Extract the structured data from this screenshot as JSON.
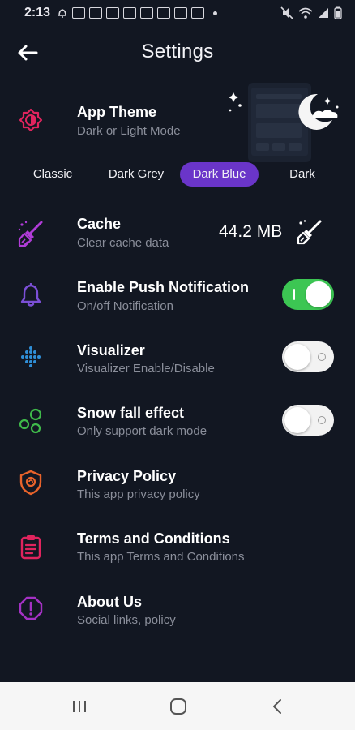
{
  "status_bar": {
    "time": "2:13",
    "notification_count": 8
  },
  "header": {
    "title": "Settings",
    "back_icon": "arrow-left-icon"
  },
  "theme": {
    "title": "App Theme",
    "subtitle": "Dark or Light Mode",
    "icon": "brightness-icon",
    "icon_color": "#e0245e",
    "options": [
      "Classic",
      "Dark Grey",
      "Dark Blue",
      "Dark"
    ],
    "selected": "Dark Blue",
    "selected_color": "#6a35c9"
  },
  "cache": {
    "title": "Cache",
    "subtitle": "Clear cache data",
    "size": "44.2 MB",
    "icon": "broom-icon",
    "icon_color": "#b03cd8"
  },
  "push_notification": {
    "title": "Enable Push Notification",
    "subtitle": "On/off Notification",
    "enabled": true,
    "icon": "bell-icon",
    "icon_color": "#7b4fd6"
  },
  "visualizer": {
    "title": "Visualizer",
    "subtitle": "Visualizer Enable/Disable",
    "enabled": false,
    "icon": "waveform-icon",
    "icon_color": "#2f8fd8"
  },
  "snow_fall": {
    "title": "Snow fall effect",
    "subtitle": "Only support dark mode",
    "enabled": false,
    "icon": "bubbles-icon",
    "icon_color": "#3fb94a"
  },
  "privacy_policy": {
    "title": "Privacy Policy",
    "subtitle": "This app privacy policy",
    "icon": "shield-icon",
    "icon_color": "#e8632b"
  },
  "terms": {
    "title": "Terms and Conditions",
    "subtitle": "This app Terms and Conditions",
    "icon": "clipboard-icon",
    "icon_color": "#e0245e"
  },
  "about": {
    "title": "About Us",
    "subtitle": "Social links, policy",
    "icon": "info-circle-icon",
    "icon_color": "#a431c4"
  },
  "colors": {
    "background": "#121722",
    "toggle_on": "#3cc653",
    "subtitle": "#8a8e9a"
  }
}
